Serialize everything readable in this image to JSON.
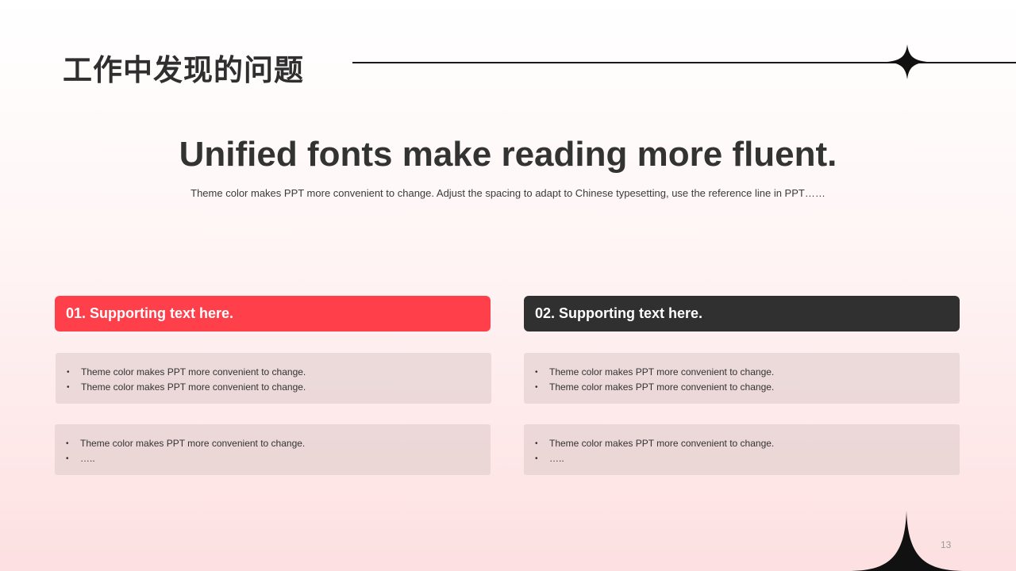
{
  "slide": {
    "title": "工作中发现的问题",
    "headline": "Unified fonts make reading more fluent.",
    "subtext": "Theme color makes PPT more convenient to change. Adjust the spacing to adapt to Chinese typesetting, use the reference line in PPT……",
    "page_number": "13"
  },
  "columns": [
    {
      "header": "01. Supporting text here.",
      "header_color": "#ff404b",
      "boxes": [
        [
          "Theme color makes PPT more convenient to change.",
          "Theme color makes PPT more convenient to change."
        ],
        [
          "Theme color makes PPT more convenient to change.",
          "….."
        ]
      ]
    },
    {
      "header": "02. Supporting text here.",
      "header_color": "#303030",
      "boxes": [
        [
          "Theme color makes PPT more convenient to change.",
          "Theme color makes PPT more convenient to change."
        ],
        [
          "Theme color makes PPT more convenient to change.",
          "….."
        ]
      ]
    }
  ],
  "icons": {
    "star": "four-point-star-icon",
    "corner": "curved-peak-shape"
  },
  "colors": {
    "accent": "#ff404b",
    "dark": "#303030",
    "text": "#333333"
  }
}
